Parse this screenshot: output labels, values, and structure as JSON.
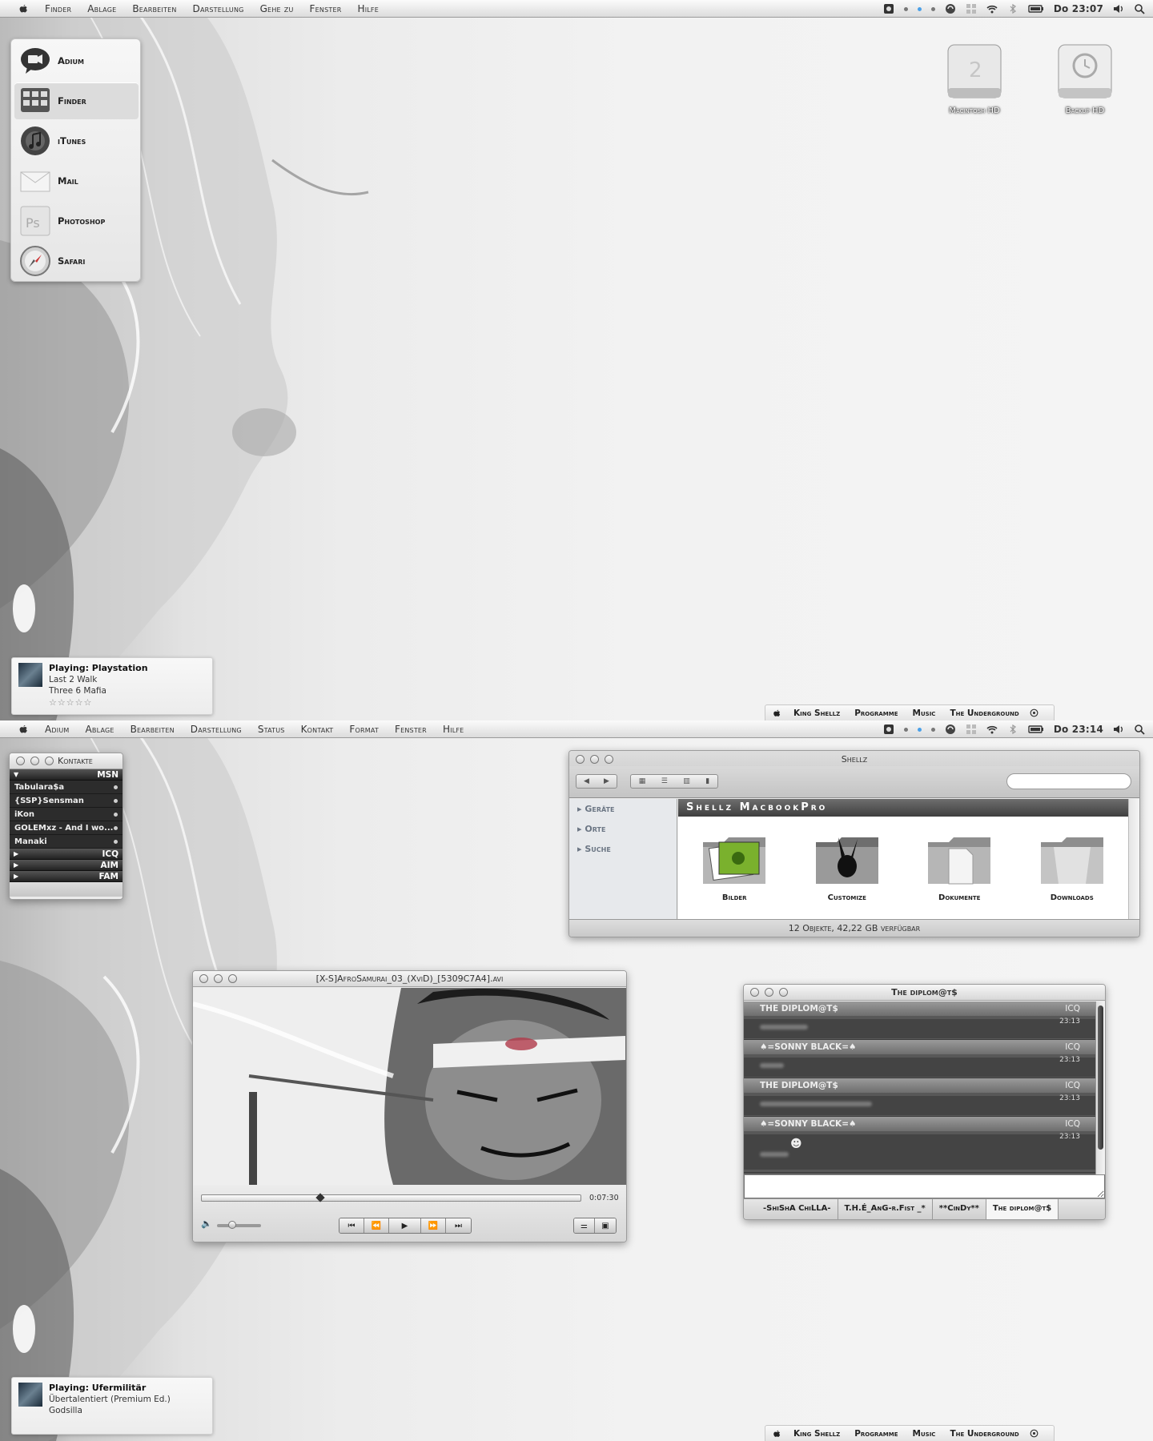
{
  "screen1": {
    "menu": {
      "items": [
        "Finder",
        "Ablage",
        "Bearbeiten",
        "Darstellung",
        "Gehe zu",
        "Fenster",
        "Hilfe"
      ],
      "clock": "Do 23:07"
    },
    "launcher": {
      "items": [
        {
          "label": "Adium",
          "icon": "adium-icon"
        },
        {
          "label": "Finder",
          "icon": "finder-icon",
          "selected": true
        },
        {
          "label": "iTunes",
          "icon": "itunes-icon"
        },
        {
          "label": "Mail",
          "icon": "mail-icon"
        },
        {
          "label": "Photoshop",
          "icon": "photoshop-icon"
        },
        {
          "label": "Safari",
          "icon": "safari-icon"
        }
      ]
    },
    "desktop_icons": [
      {
        "label": "Macintosh HD",
        "icon": "hard-drive-icon"
      },
      {
        "label": "Backup HD",
        "icon": "time-machine-drive-icon"
      }
    ],
    "now_playing": {
      "title": "Playing: Playstation",
      "track": "Last 2 Walk",
      "artist": "Three 6 Mafia",
      "stars": "☆☆☆☆☆"
    },
    "dock": [
      "King Shellz",
      "Programme",
      "Music",
      "The Underground"
    ]
  },
  "screen2": {
    "menu": {
      "items": [
        "Adium",
        "Ablage",
        "Bearbeiten",
        "Darstellung",
        "Status",
        "Kontakt",
        "Format",
        "Fenster",
        "Hilfe"
      ],
      "clock": "Do 23:14"
    },
    "contacts": {
      "title": "Kontakte",
      "groups": [
        {
          "name": "MSN",
          "expanded": true
        },
        {
          "name": "ICQ"
        },
        {
          "name": "AIM"
        },
        {
          "name": "FAM"
        }
      ],
      "msn_contacts": [
        "Tabulara$a",
        "{SSP}Sensman",
        "iKon",
        "GOLEMxz - And I wo...",
        "Manaki"
      ]
    },
    "finder": {
      "title": "Shellz",
      "sidebar": [
        "Geräte",
        "Orte",
        "Suche"
      ],
      "header": "Shellz MacbookPro",
      "items": [
        {
          "label": "Bilder",
          "icon": "pictures-folder-icon"
        },
        {
          "label": "Customize",
          "icon": "playboy-folder-icon"
        },
        {
          "label": "Dokumente",
          "icon": "documents-folder-icon"
        },
        {
          "label": "Downloads",
          "icon": "downloads-folder-icon"
        }
      ],
      "status": "12 Objekte, 42,22 GB verfügbar"
    },
    "player": {
      "title": "[X-S]AfroSamurai_03_(XviD)_[5309C7A4].avi",
      "time": "0:07:30",
      "progress": 0.31,
      "volume": 0.3
    },
    "chat": {
      "title": "The diplom@t$",
      "messages": [
        {
          "sender": "THE DIPLOM@T$",
          "proto": "ICQ",
          "time": "23:13"
        },
        {
          "sender": "♠=SONNY BLACK=♠",
          "proto": "ICQ",
          "time": "23:13"
        },
        {
          "sender": "THE DIPLOM@T$",
          "proto": "ICQ",
          "time": "23:13"
        },
        {
          "sender": "♠=SONNY BLACK=♠",
          "proto": "ICQ",
          "time": "23:13"
        }
      ],
      "tabs": [
        "-ShiShA ChiLLA-",
        "T.H.É_AnG-r.Fist _*",
        "**CinDy**",
        "The diplom@t$"
      ]
    },
    "now_playing": {
      "title": "Playing: Ufermilitär",
      "track": "Übertalentiert (Premium Ed.)",
      "artist": "Godsilla"
    },
    "dock": [
      "King Shellz",
      "Programme",
      "Music",
      "The Underground"
    ]
  }
}
